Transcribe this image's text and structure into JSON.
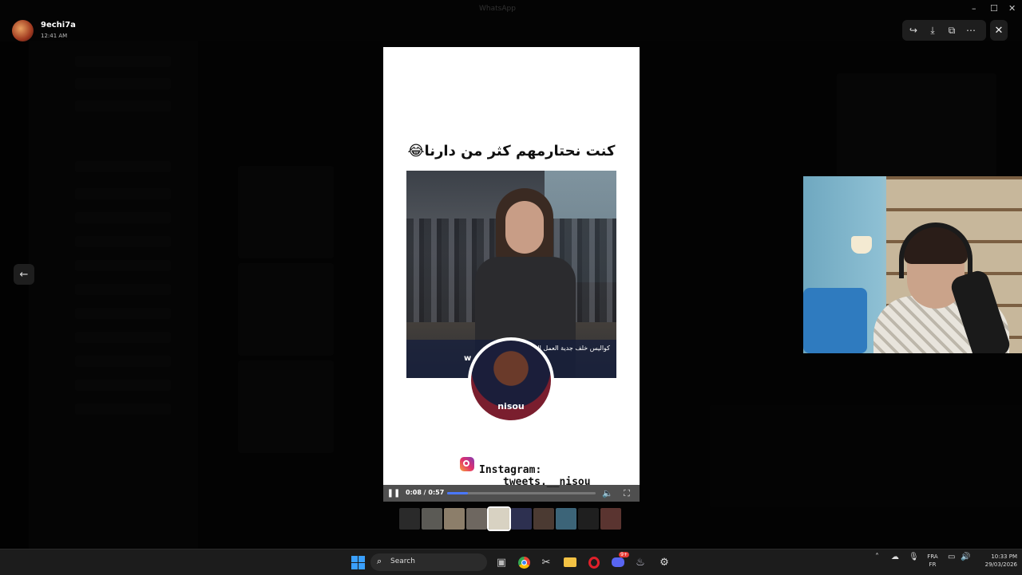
{
  "viewer": {
    "sender_name": "9echi7a",
    "sent_time": "12:41 AM",
    "window_title": "WhatsApp",
    "toolbar": {
      "forward_icon": "forward-icon",
      "download_icon": "download-icon",
      "open_external_icon": "open-external-icon",
      "more_icon": "more-icon",
      "close_icon": "close-icon"
    }
  },
  "video": {
    "caption": "كنت نحتارمهم كثر من دارنا😂",
    "lower_third_line1": "كواليس خلف جدية العمل الصحفي",
    "lower_third_line2": "w",
    "channel_name": "nisou",
    "instagram_label": "Instagram:",
    "instagram_handle": "tweets.__nisou",
    "current_time": "0:08",
    "duration": "0:57",
    "time_display": "0:08 / 0:57",
    "progress_fraction": 0.14,
    "colors": {
      "progress": "#4a78ff",
      "frame": "#ffffff"
    }
  },
  "thumbnails": {
    "count": 10,
    "active_index": 4
  },
  "taskbar": {
    "search_label": "Search",
    "language_top": "FRA",
    "language_bottom": "FR",
    "time": "10:33 PM",
    "date": "29/03/2026",
    "discord_badge": "9+"
  }
}
